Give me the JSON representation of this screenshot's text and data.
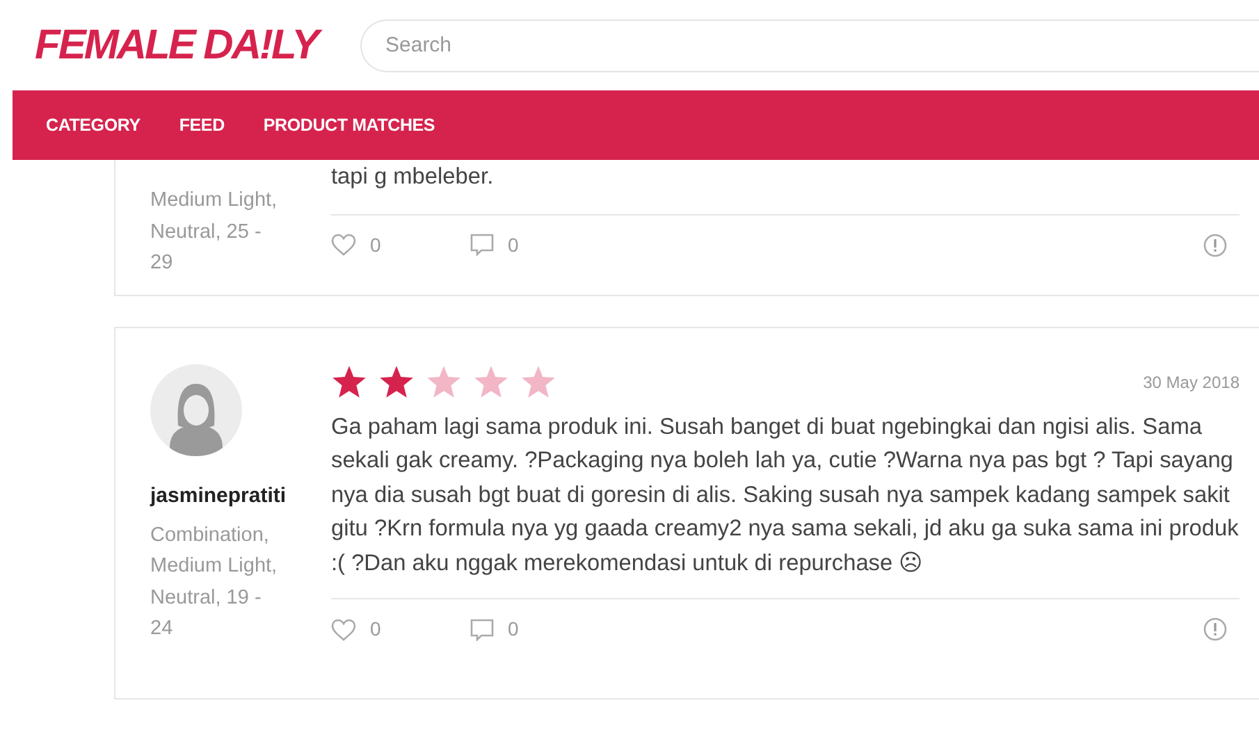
{
  "header": {
    "logo": "FEMALE DA!LY",
    "search": {
      "placeholder": "Search"
    }
  },
  "nav": [
    {
      "label": "CATEGORY"
    },
    {
      "label": "FEED"
    },
    {
      "label": "PRODUCT MATCHES"
    }
  ],
  "reviews": [
    {
      "skin": "Medium Light, Neutral, 25 - 29",
      "text": "tapi g mbeleber.",
      "likes": "0",
      "comments": "0"
    },
    {
      "username": "jasminepratiti",
      "skin": "Combination, Medium Light, Neutral, 19 - 24",
      "stars": 2,
      "date": "30 May 2018",
      "text": "Ga paham lagi sama produk ini. Susah banget di buat ngebingkai dan ngisi alis. Sama sekali gak creamy. ?Packaging nya boleh lah ya, cutie ?Warna nya pas bgt ? Tapi sayang nya dia susah bgt buat di goresin di alis. Saking susah nya sampek kadang sampek sakit gitu ?Krn formula nya yg gaada creamy2 nya sama sekali, jd aku ga suka sama ini produk :( ?Dan aku nggak merekomendasi untuk di repurchase ☹",
      "likes": "0",
      "comments": "0"
    }
  ]
}
